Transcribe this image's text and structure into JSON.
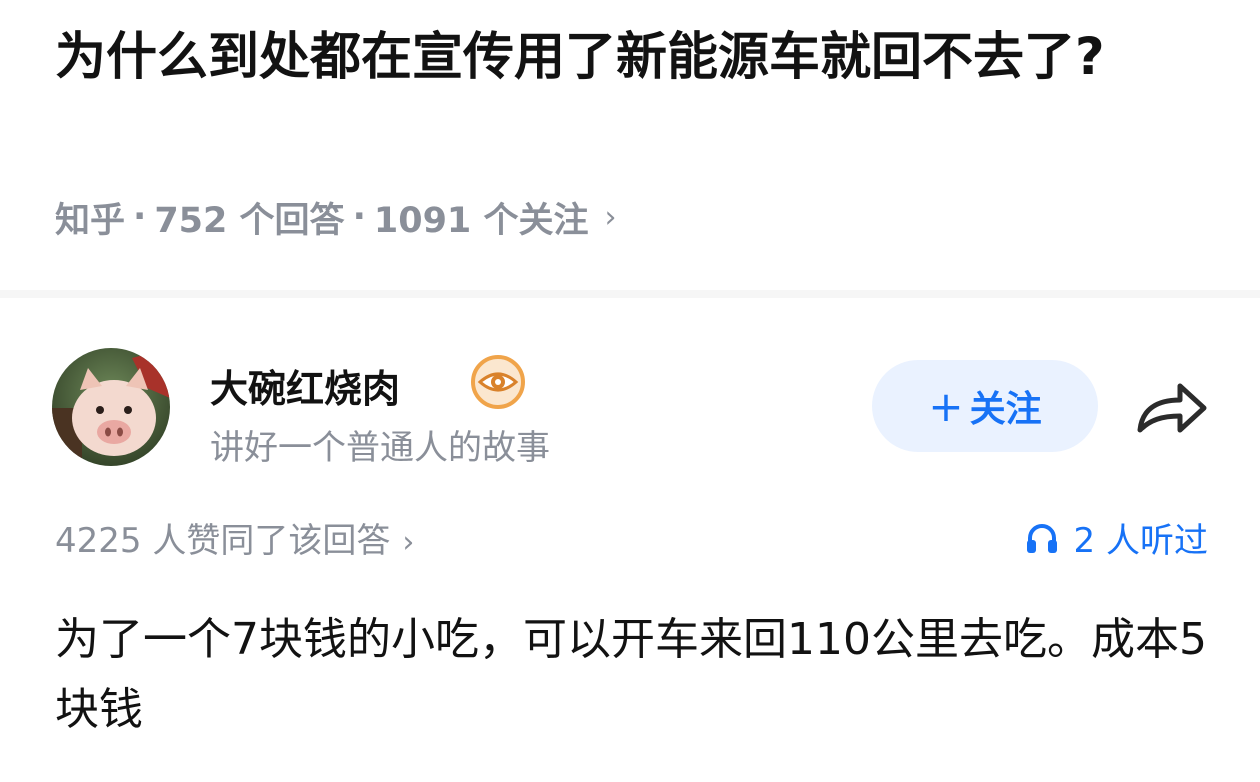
{
  "question": {
    "title": "为什么到处都在宣传用了新能源车就回不去了?",
    "source": "知乎",
    "separator": "·",
    "answers": "752 个回答",
    "followers": "1091 个关注",
    "chevron": "›"
  },
  "author": {
    "name": "大碗红烧肉",
    "bio": "讲好一个普通人的故事",
    "avatar_icon": "pig-avatar",
    "badge_icon": "eye-badge-icon"
  },
  "actions": {
    "follow_plus": "+",
    "follow_label": "关注",
    "share_icon": "share-arrow-icon"
  },
  "stats": {
    "votes": "4225 人赞同了该回答",
    "votes_chevron": "›",
    "listened": "2 人听过",
    "listened_icon": "headphones-icon"
  },
  "answer": {
    "text": "为了一个7块钱的小吃，可以开车来回110公里去吃。成本5块钱"
  },
  "colors": {
    "accent": "#1772f6",
    "follow_bg": "#eaf2ff",
    "meta": "#8a8f99",
    "text": "#121212",
    "badge": "#f0a44a"
  }
}
